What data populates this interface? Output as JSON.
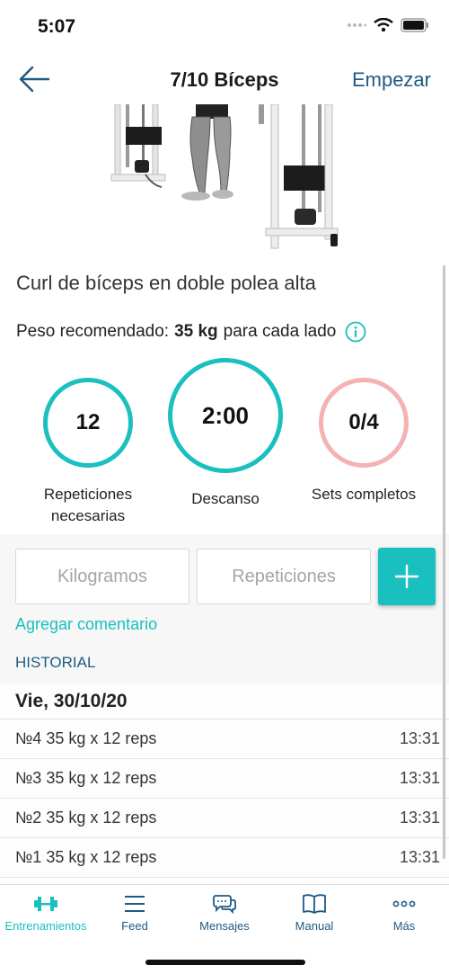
{
  "status_bar": {
    "time": "5:07"
  },
  "nav": {
    "title": "7/10 Bíceps",
    "start_label": "Empezar"
  },
  "exercise": {
    "name": "Curl de bíceps en doble polea alta",
    "weight_prefix": "Peso recomendado:",
    "weight_value": "35 kg",
    "weight_suffix": "para cada lado"
  },
  "stats": {
    "reps_value": "12",
    "reps_label": "Repeticiones necesarias",
    "rest_value": "2:00",
    "rest_label": "Descanso",
    "sets_value": "0/4",
    "sets_label": "Sets completos"
  },
  "inputs": {
    "kg_placeholder": "Kilogramos",
    "reps_placeholder": "Repeticiones"
  },
  "comment_link": "Agregar comentario",
  "history": {
    "label": "HISTORIAL",
    "day": "Vie, 30/10/20",
    "rows": [
      {
        "text": "№4 35 kg x 12 reps",
        "time": "13:31"
      },
      {
        "text": "№3 35 kg x 12 reps",
        "time": "13:31"
      },
      {
        "text": "№2 35 kg x 12 reps",
        "time": "13:31"
      },
      {
        "text": "№1 35 kg x 12 reps",
        "time": "13:31"
      }
    ]
  },
  "tabs": [
    {
      "label": "Entrenamientos",
      "icon": "dumbbell-icon",
      "active": true
    },
    {
      "label": "Feed",
      "icon": "feed-lines-icon"
    },
    {
      "label": "Mensajes",
      "icon": "chat-bubbles-icon"
    },
    {
      "label": "Manual",
      "icon": "open-book-icon"
    },
    {
      "label": "Más",
      "icon": "more-dots-icon"
    }
  ],
  "colors": {
    "accent": "#1abfbf",
    "nav_blue": "#1f5a84",
    "sets_ring": "#f5b2b2"
  }
}
